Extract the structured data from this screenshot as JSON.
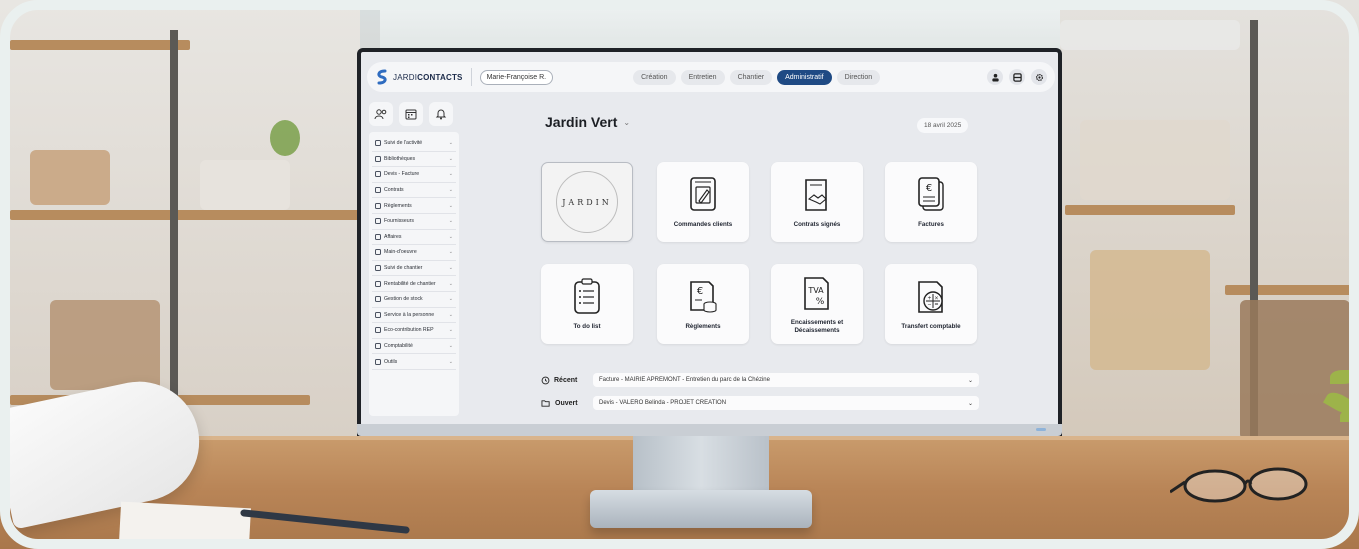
{
  "app": {
    "brand_prefix": "JARDI",
    "brand_suffix": "CONTACTS",
    "user_name": "Marie-Françoise R."
  },
  "tabs": [
    {
      "label": "Création",
      "active": false
    },
    {
      "label": "Entretien",
      "active": false
    },
    {
      "label": "Chantier",
      "active": false
    },
    {
      "label": "Administratif",
      "active": true
    },
    {
      "label": "Direction",
      "active": false
    }
  ],
  "sidebar": {
    "items": [
      {
        "label": "Suivi de l'activité",
        "icon": "activity-icon"
      },
      {
        "label": "Bibliothèques",
        "icon": "library-icon"
      },
      {
        "label": "Devis - Facture",
        "icon": "invoice-icon"
      },
      {
        "label": "Contrats",
        "icon": "contract-icon"
      },
      {
        "label": "Règlements",
        "icon": "payment-icon"
      },
      {
        "label": "Fournisseurs",
        "icon": "truck-icon"
      },
      {
        "label": "Affaires",
        "icon": "folder-icon"
      },
      {
        "label": "Main-d'oeuvre",
        "icon": "workforce-icon"
      },
      {
        "label": "Suivi de chantier",
        "icon": "site-icon"
      },
      {
        "label": "Rentabilité de chantier",
        "icon": "profit-icon"
      },
      {
        "label": "Gestion de stock",
        "icon": "stock-icon"
      },
      {
        "label": "Service à la personne",
        "icon": "service-icon"
      },
      {
        "label": "Éco-contribution REP",
        "icon": "eco-icon"
      },
      {
        "label": "Comptabilité",
        "icon": "accounting-icon"
      },
      {
        "label": "Outils",
        "icon": "tools-icon"
      }
    ]
  },
  "main": {
    "branch_name": "Jardin Vert",
    "date": "18 avril 2025",
    "logo_word": "JARDIN",
    "tiles": [
      {
        "label": "Commandes clients",
        "icon": "order-form-icon"
      },
      {
        "label": "Contrats signés",
        "icon": "handshake-contract-icon"
      },
      {
        "label": "Factures",
        "icon": "euro-invoice-icon"
      },
      {
        "label": "To do list",
        "icon": "checklist-icon"
      },
      {
        "label": "Règlements",
        "icon": "euro-coins-icon"
      },
      {
        "label": "Encaissements et Décaissements",
        "icon": "tva-icon"
      },
      {
        "label": "Transfert comptable",
        "icon": "calculator-icon"
      }
    ],
    "recent": {
      "label": "Récent",
      "value": "Facture - MAIRIE APREMONT - Entretien du parc de la Chézine"
    },
    "opened": {
      "label": "Ouvert",
      "value": "Devis - VALERO Belinda - PROJET CREATION"
    }
  },
  "colors": {
    "accent": "#1f4a84",
    "tile_bg": "#fbfbfc",
    "screen_bg": "#e8eaee"
  }
}
